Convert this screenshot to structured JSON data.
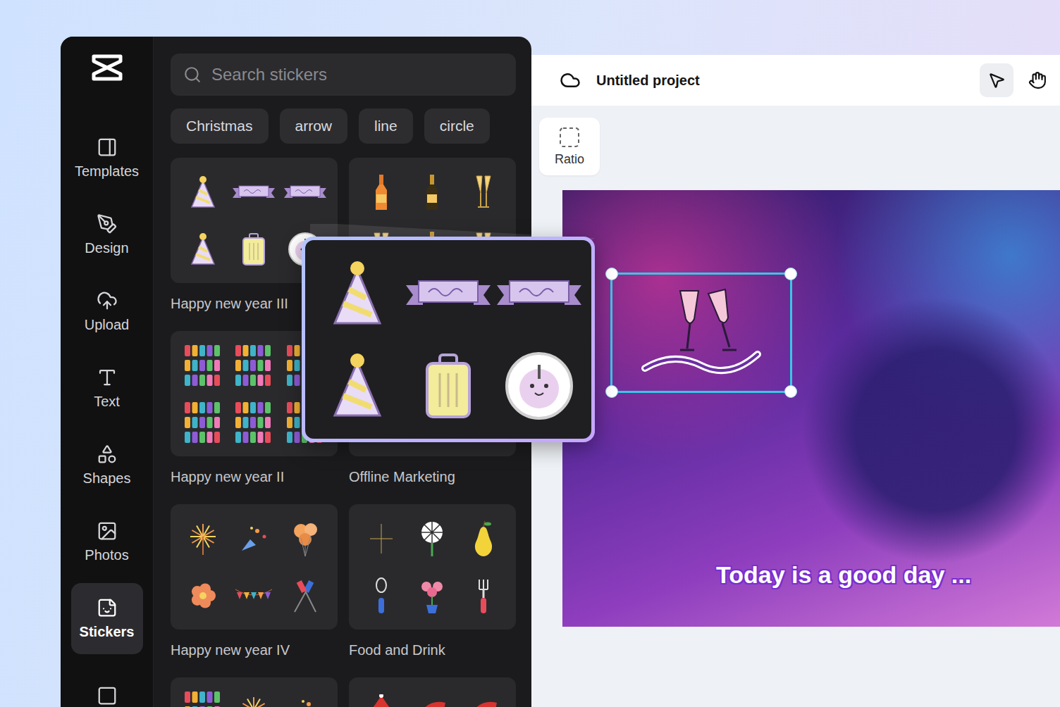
{
  "nav": {
    "items": [
      {
        "label": "Templates",
        "selected": false
      },
      {
        "label": "Design",
        "selected": false
      },
      {
        "label": "Upload",
        "selected": false
      },
      {
        "label": "Text",
        "selected": false
      },
      {
        "label": "Shapes",
        "selected": false
      },
      {
        "label": "Photos",
        "selected": false
      },
      {
        "label": "Stickers",
        "selected": true
      }
    ]
  },
  "search": {
    "placeholder": "Search stickers"
  },
  "chips": [
    "Christmas",
    "arrow",
    "line",
    "circle"
  ],
  "packs": [
    {
      "label": "Happy new year III",
      "kind": "party"
    },
    {
      "kind": "champagne"
    },
    {
      "label": "Happy new year II",
      "kind": "textart"
    },
    {
      "label": "Offline Marketing",
      "kind": "marketing"
    },
    {
      "label": "Happy new year IV",
      "kind": "celebrate"
    },
    {
      "label": "Food and Drink",
      "kind": "food"
    },
    {
      "kind": "newyear"
    },
    {
      "kind": "christmas"
    }
  ],
  "project": {
    "title": "Untitled project"
  },
  "ratio": {
    "label": "Ratio"
  },
  "canvas": {
    "caption": "Today is a good day ...",
    "sticker_selected": true
  },
  "preview": {
    "open": true,
    "kind": "party"
  }
}
